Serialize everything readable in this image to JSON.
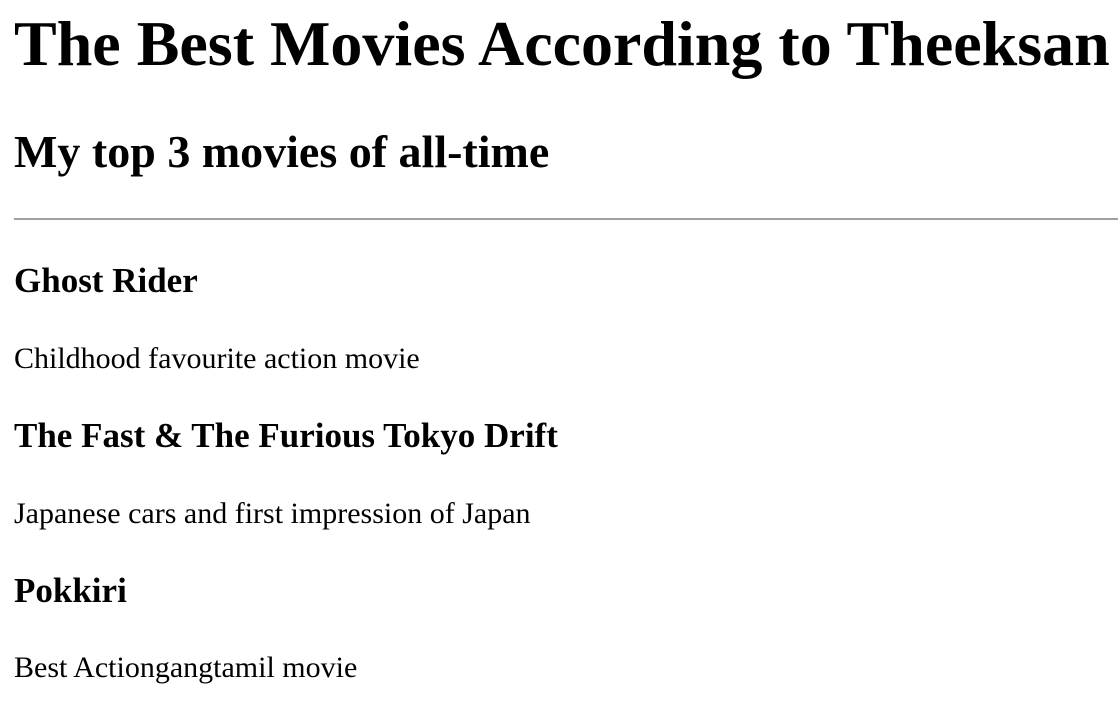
{
  "header": {
    "title": "The Best Movies According to Theeksan",
    "subtitle": "My top 3 movies of all-time"
  },
  "movies": [
    {
      "title": "Ghost Rider",
      "description": "Childhood favourite action movie"
    },
    {
      "title": "The Fast & The Furious Tokyo Drift",
      "description": "Japanese cars and first impression of Japan"
    },
    {
      "title": "Pokkiri",
      "description": "Best Actiongangtamil movie"
    }
  ]
}
